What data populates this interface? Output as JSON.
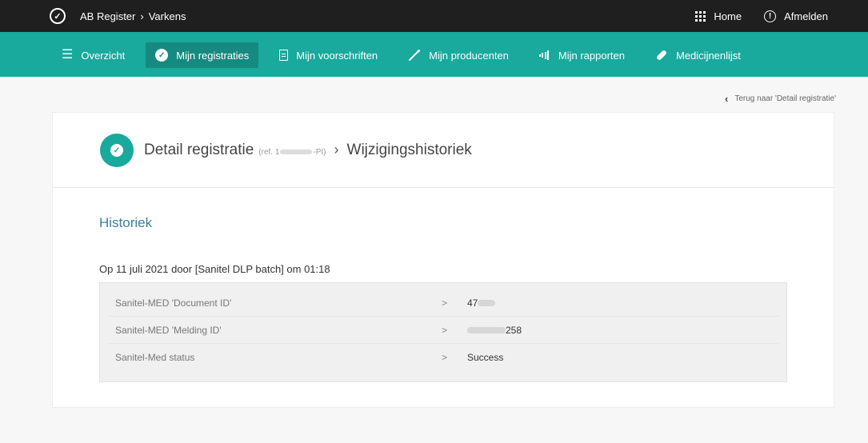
{
  "topbar": {
    "breadcrumb_app": "AB Register",
    "breadcrumb_section": "Varkens",
    "home_label": "Home",
    "logout_label": "Afmelden"
  },
  "nav": {
    "items": [
      {
        "label": "Overzicht",
        "icon": "list-icon"
      },
      {
        "label": "Mijn registraties",
        "icon": "check-circle-icon",
        "active": true
      },
      {
        "label": "Mijn voorschriften",
        "icon": "document-icon"
      },
      {
        "label": "Mijn producenten",
        "icon": "syringe-icon"
      },
      {
        "label": "Mijn rapporten",
        "icon": "bar-chart-icon"
      },
      {
        "label": "Medicijnenlijst",
        "icon": "pill-icon"
      }
    ]
  },
  "back_link": "Terug naar 'Detail registratie'",
  "header": {
    "title": "Detail registratie",
    "ref_prefix": "(ref. 1",
    "ref_suffix": "-PI)",
    "subtitle": "Wijzigingshistoriek"
  },
  "history": {
    "section_title": "Historiek",
    "entry_meta": "Op 11 juli 2021 door [Sanitel DLP batch] om 01:18",
    "changes": [
      {
        "field": "Sanitel-MED 'Document ID'",
        "arrow": ">",
        "value": "47"
      },
      {
        "field": "Sanitel-MED 'Melding ID'",
        "arrow": ">",
        "value": "258"
      },
      {
        "field": "Sanitel-Med status",
        "arrow": ">",
        "value": "Success"
      }
    ]
  },
  "colors": {
    "topbar": "#1f1f1f",
    "nav": "#19a99d",
    "nav_active": "#168a80",
    "section_title": "#3a7fa0"
  }
}
